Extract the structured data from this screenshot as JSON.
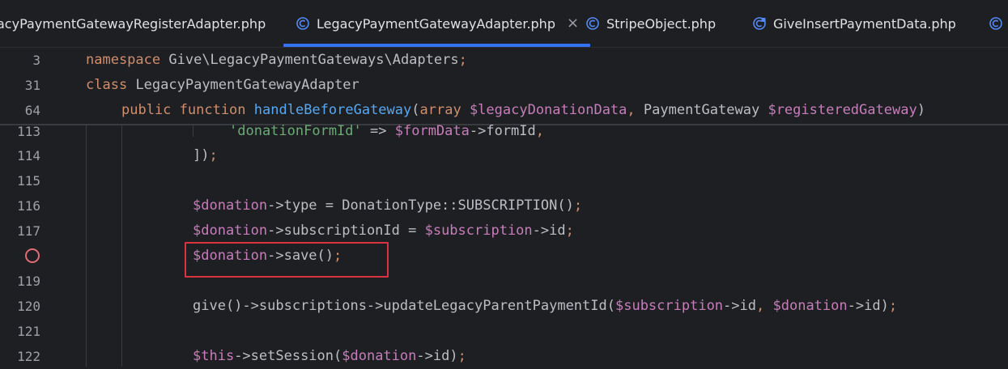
{
  "tabs": [
    {
      "label": "acyPaymentGatewayRegisterAdapter.php",
      "active": false
    },
    {
      "label": "LegacyPaymentGatewayAdapter.php",
      "active": true,
      "close": "×"
    },
    {
      "label": "StripeObject.php",
      "active": false
    },
    {
      "label": "GiveInsertPaymentData.php",
      "active": false
    }
  ],
  "editor": {
    "sticky_lines": [
      {
        "number": "3",
        "text": "namespace Give\\LegacyPaymentGateways\\Adapters;"
      },
      {
        "number": "31",
        "text": "class LegacyPaymentGatewayAdapter"
      },
      {
        "number": "64",
        "text": "public function handleBeforeGateway(array $legacyDonationData, PaymentGateway $registeredGateway)"
      }
    ],
    "lines": [
      {
        "number": "113",
        "text": "'donationFormId' => $formData->formId,"
      },
      {
        "number": "114",
        "text": "]);"
      },
      {
        "number": "115",
        "text": ""
      },
      {
        "number": "116",
        "text": "$donation->type = DonationType::SUBSCRIPTION();"
      },
      {
        "number": "117",
        "text": "$donation->subscriptionId = $subscription->id;"
      },
      {
        "number": "",
        "text": "$donation->save();",
        "breakpoint": true,
        "highlighted": true
      },
      {
        "number": "119",
        "text": ""
      },
      {
        "number": "120",
        "text": "give()->subscriptions->updateLegacyParentPaymentId($subscription->id, $donation->id);"
      },
      {
        "number": "121",
        "text": ""
      },
      {
        "number": "122",
        "text": "$this->setSession($donation->id);"
      }
    ]
  },
  "colors": {
    "background": "#1e1f22",
    "keyword": "#cf8e6d",
    "variable": "#c77dbb",
    "string": "#6aab73",
    "function": "#56a8f5",
    "text": "#bcbec4",
    "tab_accent": "#3574f0",
    "highlight_box": "#d9333f"
  }
}
